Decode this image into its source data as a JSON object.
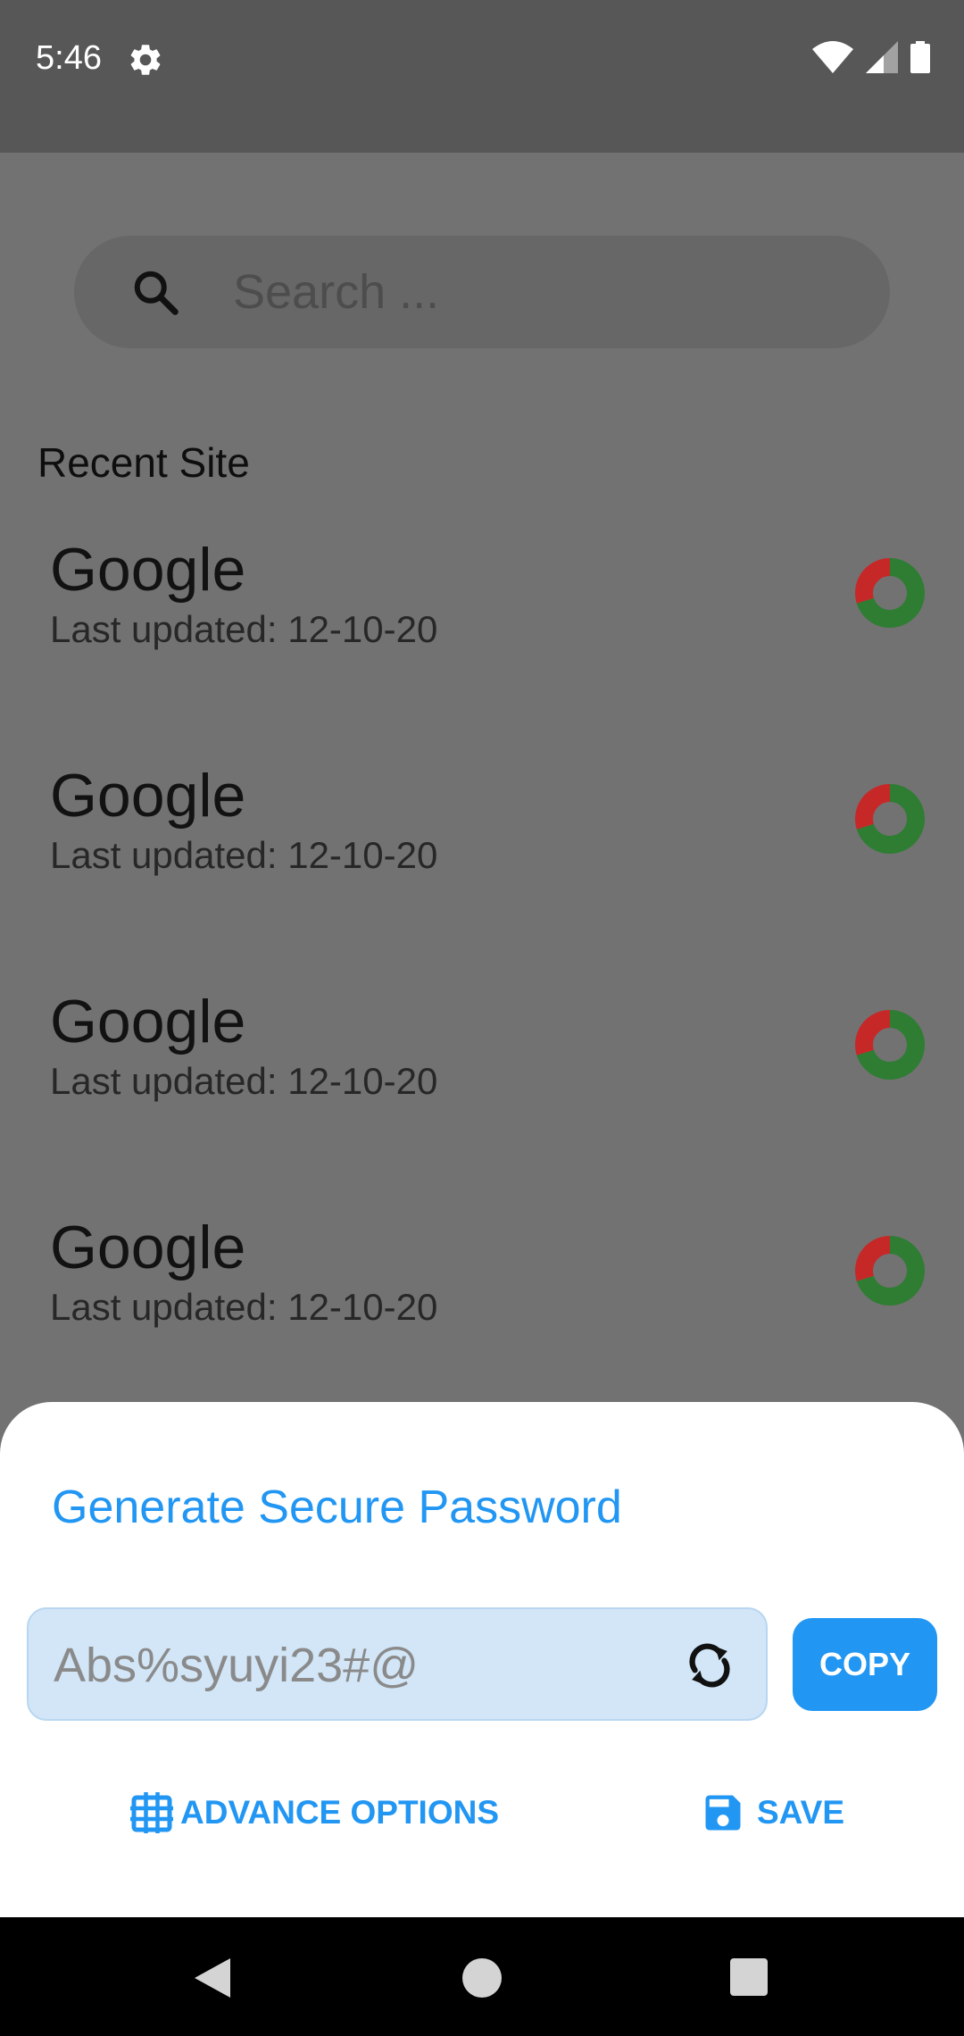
{
  "status_bar": {
    "time": "5:46",
    "icons": [
      "gear-icon",
      "wifi-icon",
      "signal-icon",
      "battery-icon"
    ]
  },
  "search": {
    "placeholder": "Search ...",
    "icon": "search-icon"
  },
  "recent": {
    "title": "Recent Site",
    "items": [
      {
        "name": "Google",
        "updated": "Last updated: 12-10-20",
        "strength": {
          "weak": 0.3,
          "strong": 0.7
        }
      },
      {
        "name": "Google",
        "updated": "Last updated: 12-10-20",
        "strength": {
          "weak": 0.3,
          "strong": 0.7
        }
      },
      {
        "name": "Google",
        "updated": "Last updated: 12-10-20",
        "strength": {
          "weak": 0.3,
          "strong": 0.7
        }
      },
      {
        "name": "Google",
        "updated": "Last updated: 12-10-20",
        "strength": {
          "weak": 0.3,
          "strong": 0.7
        }
      }
    ]
  },
  "sheet": {
    "title": "Generate Secure Password",
    "password_value": "Abs%syuyi23#@",
    "copy_label": "COPY",
    "advance_label": "ADVANCE OPTIONS",
    "save_label": "SAVE"
  },
  "colors": {
    "accent": "#2196f3",
    "scrim_bg": "#727272",
    "donut_strong": "#2e7d32",
    "donut_weak": "#c62828"
  }
}
